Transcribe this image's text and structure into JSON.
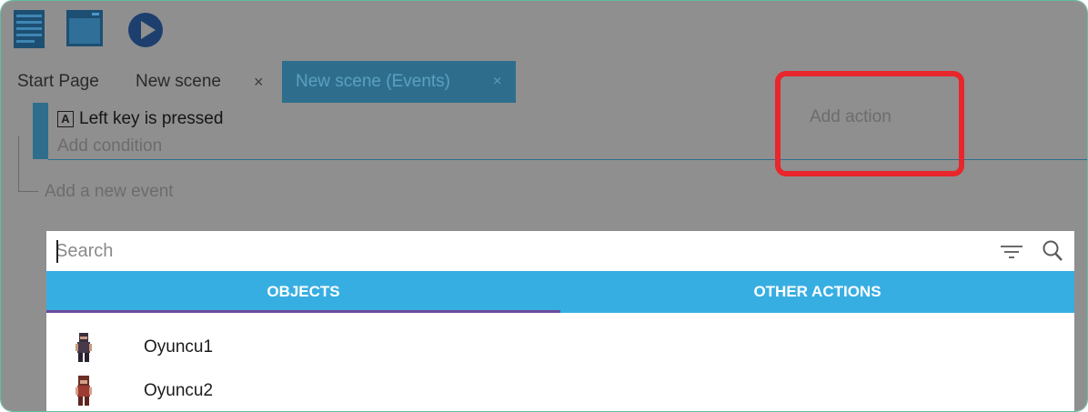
{
  "toolbar": {
    "icons": [
      "events-sheet-icon",
      "window-icon",
      "play-icon"
    ]
  },
  "tabs": [
    {
      "label": "Start Page"
    },
    {
      "label": "New scene",
      "close": "×"
    },
    {
      "label": "New scene (Events)",
      "close": "×",
      "active": true
    }
  ],
  "event": {
    "condition_key": "A",
    "condition_text": "Left key is pressed",
    "add_condition": "Add condition",
    "add_action": "Add action",
    "add_event": "Add a new event"
  },
  "dialog": {
    "search_placeholder": "Search",
    "tabs": [
      {
        "label": "OBJECTS",
        "active": true
      },
      {
        "label": "OTHER ACTIONS",
        "active": false
      }
    ],
    "objects": [
      {
        "name": "Oyuncu1",
        "icon": "player1-sprite-icon"
      },
      {
        "name": "Oyuncu2",
        "icon": "player2-sprite-icon"
      }
    ]
  },
  "colors": {
    "overlay": "#8f8f8f",
    "accent": "#37aee2",
    "highlight": "#e8262b",
    "tab_underline": "#6b4a9b"
  }
}
